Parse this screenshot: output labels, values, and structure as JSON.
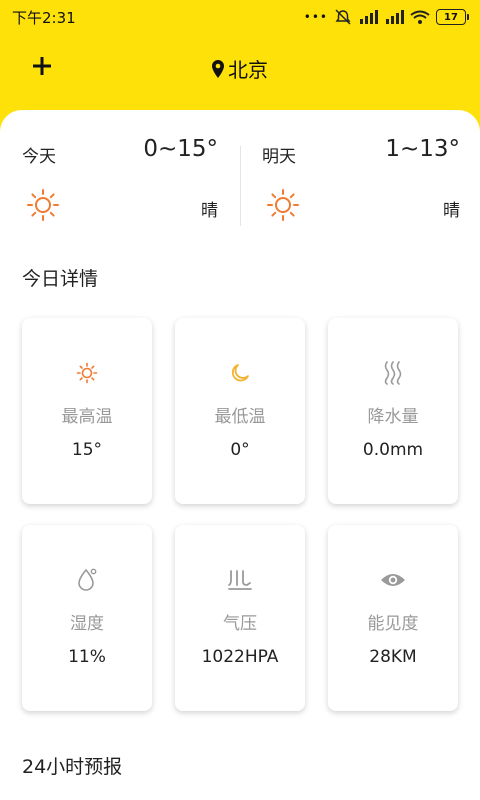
{
  "status": {
    "time": "下午2:31",
    "dots": "•••",
    "battery": "17"
  },
  "header": {
    "location": "北京",
    "add_icon": "plus-icon",
    "location_icon": "map-pin-icon"
  },
  "forecast": {
    "today": {
      "name": "今天",
      "range": "0~15°",
      "condition": "晴",
      "icon": "sun-icon"
    },
    "tomorrow": {
      "name": "明天",
      "range": "1~13°",
      "condition": "晴",
      "icon": "sun-icon"
    }
  },
  "details": {
    "title": "今日详情",
    "cards": [
      {
        "label": "最高温",
        "value": "15°",
        "icon": "sun-icon"
      },
      {
        "label": "最低温",
        "value": "0°",
        "icon": "moon-icon"
      },
      {
        "label": "降水量",
        "value": "0.0mm",
        "icon": "steam-icon"
      },
      {
        "label": "湿度",
        "value": "11%",
        "icon": "droplet-icon"
      },
      {
        "label": "气压",
        "value": "1022HPA",
        "icon": "pressure-icon"
      },
      {
        "label": "能见度",
        "value": "28KM",
        "icon": "eye-icon"
      }
    ]
  },
  "hourly": {
    "title": "24小时预报"
  },
  "colors": {
    "header_bg": "#FFE10A",
    "sun_orange": "#F07A30",
    "moon_yellow": "#F2B22E",
    "icon_gray": "#9a9a9a"
  }
}
